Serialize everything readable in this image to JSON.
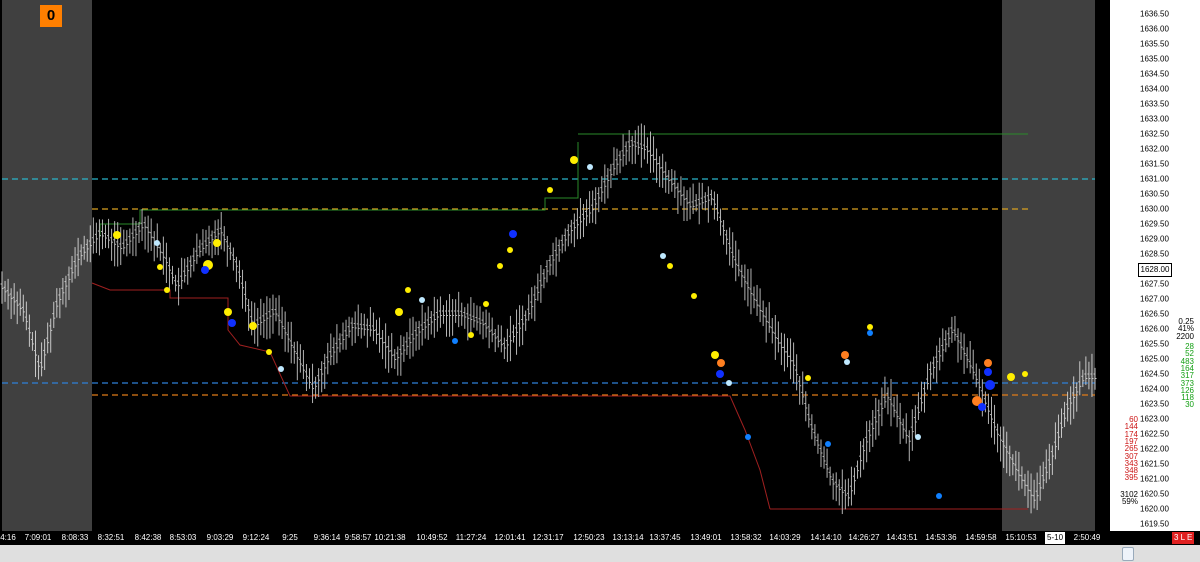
{
  "badge": "0",
  "chart_data": {
    "type": "candlestick",
    "ylim": [
      1619.0,
      1637.5
    ],
    "y_ticks": [
      "1636.50",
      "1636.00",
      "1635.50",
      "1635.00",
      "1634.50",
      "1634.00",
      "1633.50",
      "1633.00",
      "1632.50",
      "1632.00",
      "1631.50",
      "1631.00",
      "1630.50",
      "1630.00",
      "1629.50",
      "1629.00",
      "1628.50",
      "1628.00",
      "1627.50",
      "1627.00",
      "1626.50",
      "1626.00",
      "1625.50",
      "1625.00",
      "1624.50",
      "1624.00",
      "1623.50",
      "1623.00",
      "1622.50",
      "1622.00",
      "1621.50",
      "1621.00",
      "1620.50",
      "1620.00",
      "1619.50"
    ],
    "x_ticks": [
      "4:16",
      "7:09:01",
      "8:08:33",
      "8:32:51",
      "8:42:38",
      "8:53:03",
      "9:03:29",
      "9:12:24",
      "9:25",
      "9:36:14",
      "9:58:57",
      "10:21:38",
      "10:49:52",
      "11:27:24",
      "12:01:41",
      "12:31:17",
      "12:50:23",
      "13:13:14",
      "13:37:45",
      "13:49:01",
      "13:58:32",
      "14:03:29",
      "14:14:10",
      "14:26:27",
      "14:43:51",
      "14:53:36",
      "14:59:58",
      "15:10:53",
      "2:50:49"
    ],
    "current_price": "1628.00",
    "range_label": "5-10",
    "corner_label": "3 L E",
    "horizontal_levels": [
      {
        "price": 1631.0,
        "color": "#2ab3c8",
        "style": "dashed"
      },
      {
        "price": 1630.0,
        "color": "#d8a020",
        "style": "dashed"
      },
      {
        "price": 1624.2,
        "color": "#2f7fd8",
        "style": "dashed"
      },
      {
        "price": 1623.8,
        "color": "#e07b18",
        "style": "dashed"
      },
      {
        "price": 1632.5,
        "color": "#2a8a2a",
        "style": "solid"
      },
      {
        "price": 1620.0,
        "color": "#a02020",
        "style": "solid"
      }
    ],
    "path": [
      [
        0,
        1627.4
      ],
      [
        0.02,
        1626.6
      ],
      [
        0.035,
        1624.6
      ],
      [
        0.05,
        1626.8
      ],
      [
        0.07,
        1628.4
      ],
      [
        0.09,
        1629.2
      ],
      [
        0.11,
        1628.7
      ],
      [
        0.13,
        1629.5
      ],
      [
        0.15,
        1628.3
      ],
      [
        0.16,
        1627.4
      ],
      [
        0.18,
        1628.6
      ],
      [
        0.2,
        1629.3
      ],
      [
        0.215,
        1628.1
      ],
      [
        0.23,
        1626.1
      ],
      [
        0.25,
        1626.6
      ],
      [
        0.27,
        1625.1
      ],
      [
        0.285,
        1624.0
      ],
      [
        0.3,
        1625.1
      ],
      [
        0.32,
        1626.1
      ],
      [
        0.34,
        1626.0
      ],
      [
        0.36,
        1625.0
      ],
      [
        0.38,
        1625.9
      ],
      [
        0.4,
        1626.5
      ],
      [
        0.42,
        1626.5
      ],
      [
        0.44,
        1626.2
      ],
      [
        0.46,
        1625.4
      ],
      [
        0.48,
        1626.4
      ],
      [
        0.5,
        1628.1
      ],
      [
        0.52,
        1629.3
      ],
      [
        0.54,
        1630.0
      ],
      [
        0.56,
        1631.4
      ],
      [
        0.575,
        1632.2
      ],
      [
        0.59,
        1632.0
      ],
      [
        0.61,
        1631.0
      ],
      [
        0.63,
        1630.1
      ],
      [
        0.65,
        1630.4
      ],
      [
        0.67,
        1628.3
      ],
      [
        0.69,
        1626.9
      ],
      [
        0.71,
        1625.6
      ],
      [
        0.725,
        1624.8
      ],
      [
        0.74,
        1622.8
      ],
      [
        0.76,
        1620.9
      ],
      [
        0.775,
        1620.4
      ],
      [
        0.79,
        1622.2
      ],
      [
        0.81,
        1623.8
      ],
      [
        0.83,
        1622.3
      ],
      [
        0.85,
        1624.6
      ],
      [
        0.87,
        1626.0
      ],
      [
        0.89,
        1624.5
      ],
      [
        0.91,
        1622.6
      ],
      [
        0.93,
        1621.2
      ],
      [
        0.945,
        1620.3
      ],
      [
        0.96,
        1621.7
      ],
      [
        0.975,
        1623.4
      ],
      [
        0.99,
        1624.4
      ],
      [
        1.0,
        1624.4
      ]
    ],
    "right_counts": {
      "header": [
        "0.25",
        "41%",
        "2200"
      ],
      "green": [
        "28",
        "52",
        "483",
        "164",
        "317",
        "373",
        "126",
        "118",
        "30"
      ],
      "red": [
        "60",
        "144",
        "174",
        "197",
        "265",
        "307",
        "343",
        "348",
        "395"
      ],
      "footer": [
        "3102",
        "59%"
      ]
    }
  }
}
